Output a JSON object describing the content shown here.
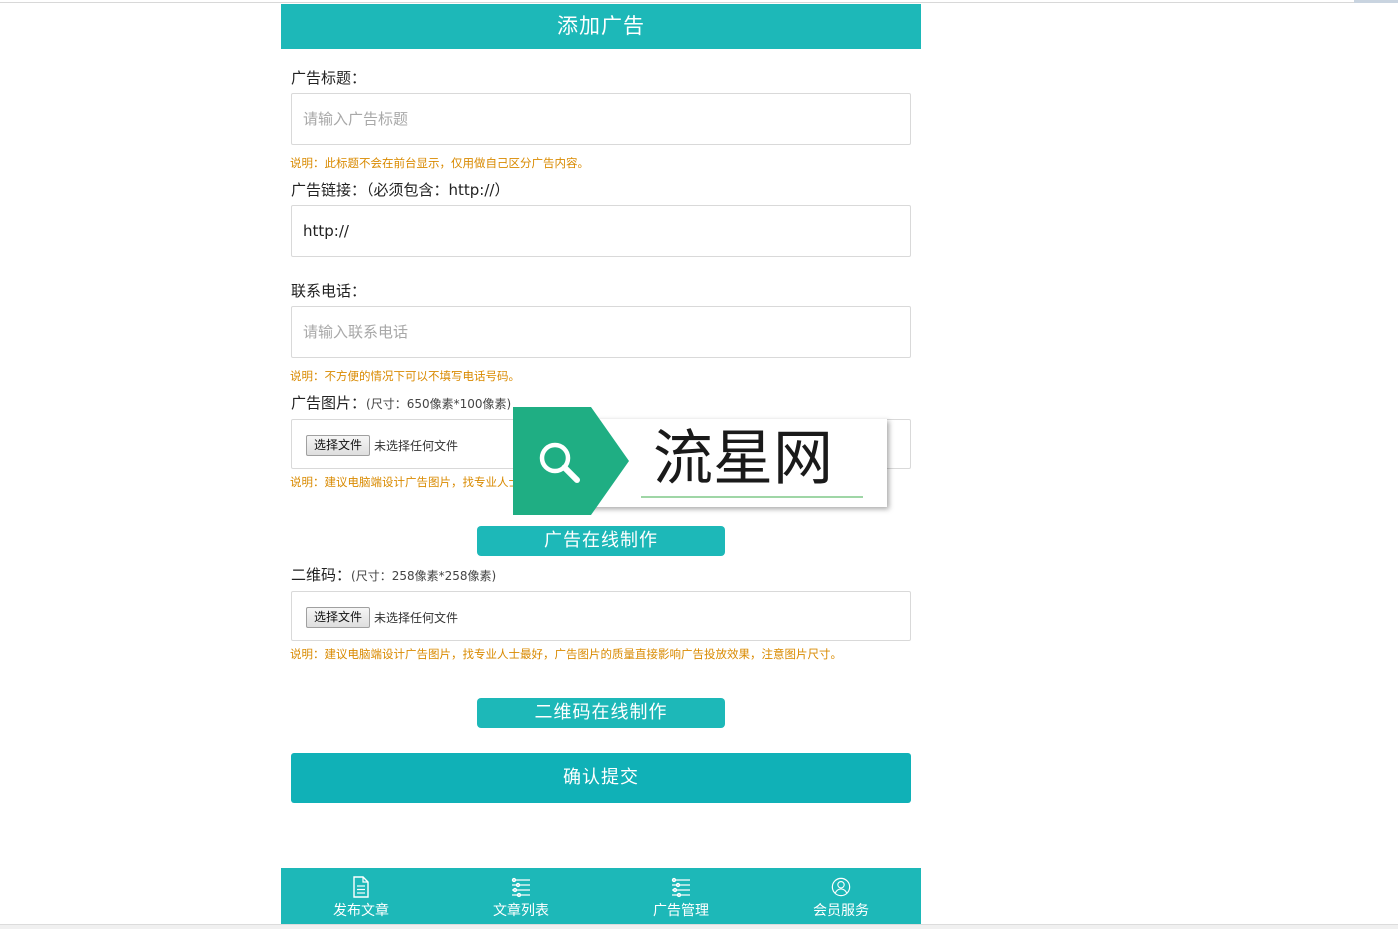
{
  "header": {
    "title": "添加广告"
  },
  "ad_title": {
    "label": "广告标题：",
    "placeholder": "请输入广告标题",
    "note": "说明：此标题不会在前台显示，仅用做自己区分广告内容。"
  },
  "ad_link": {
    "label": "广告链接：（必须包含：http://）",
    "value": "http://"
  },
  "phone": {
    "label": "联系电话：",
    "placeholder": "请输入联系电话",
    "note": "说明：不方便的情况下可以不填写电话号码。"
  },
  "ad_image": {
    "label": "广告图片：",
    "size_hint": "(尺寸：650像素*100像素)",
    "file_button": "选择文件",
    "file_status": "未选择任何文件",
    "note": "说明：建议电脑端设计广告图片，找专业人士最好，广告图片的质量直接影响广告投放效果，注意图片尺寸。",
    "online_button": "广告在线制作"
  },
  "qrcode": {
    "label": "二维码：",
    "size_hint": "(尺寸：258像素*258像素)",
    "file_button": "选择文件",
    "file_status": "未选择任何文件",
    "note": "说明：建议电脑端设计广告图片，找专业人士最好，广告图片的质量直接影响广告投放效果，注意图片尺寸。",
    "online_button": "二维码在线制作"
  },
  "submit_label": "确认提交",
  "footer": {
    "items": [
      {
        "label": "发布文章",
        "icon": "document-icon"
      },
      {
        "label": "文章列表",
        "icon": "list-icon"
      },
      {
        "label": "广告管理",
        "icon": "list-icon"
      },
      {
        "label": "会员服务",
        "icon": "user-icon"
      }
    ]
  },
  "watermark": {
    "text": "流星网",
    "icon": "search-icon"
  },
  "colors": {
    "primary": "#1db8b8",
    "submit": "#10b1b7",
    "note": "#d98a00",
    "watermark_green": "#1fae83"
  }
}
